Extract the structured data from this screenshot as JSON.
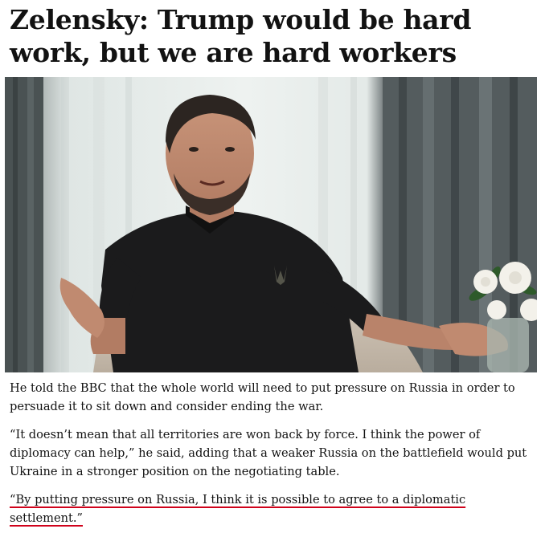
{
  "article": {
    "headline": "Zelensky: Trump would be hard work, but we are hard workers",
    "paragraphs": [
      "He told the BBC that the whole world will need to put pressure on Russia in order to persuade it to sit down and consider ending the war.",
      "“It doesn’t mean that all territories are won back by force. I think the power of diplomacy can help,” he said, adding that a weaker Russia on the battlefield would put Ukraine in a stronger position on the negotiating table.",
      "“By putting pressure on Russia, I think it is possible to agree to a diplomatic settlement.”"
    ]
  },
  "colors": {
    "underline_annotation": "#d0021b",
    "text": "#121212"
  },
  "photo": {
    "icon": "interview-photo"
  }
}
